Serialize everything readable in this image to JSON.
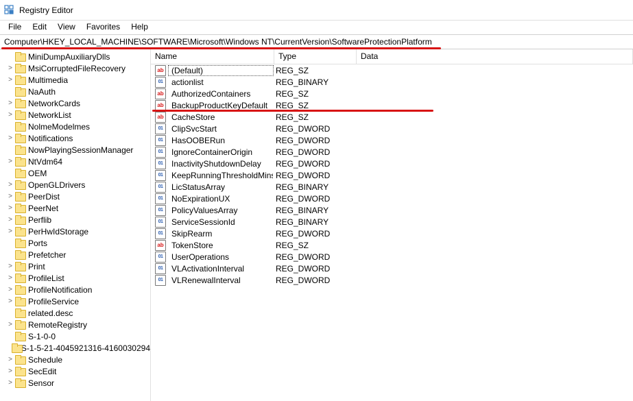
{
  "window": {
    "title": "Registry Editor"
  },
  "menu": {
    "file": "File",
    "edit": "Edit",
    "view": "View",
    "favorites": "Favorites",
    "help": "Help"
  },
  "address": "Computer\\HKEY_LOCAL_MACHINE\\SOFTWARE\\Microsoft\\Windows NT\\CurrentVersion\\SoftwareProtectionPlatform",
  "columns": {
    "name": "Name",
    "type": "Type",
    "data": "Data"
  },
  "tree_items": [
    {
      "name": "MiniDumpAuxiliaryDlls",
      "expander": ""
    },
    {
      "name": "MsiCorruptedFileRecovery",
      "expander": ">"
    },
    {
      "name": "Multimedia",
      "expander": ">"
    },
    {
      "name": "NaAuth",
      "expander": ""
    },
    {
      "name": "NetworkCards",
      "expander": ">"
    },
    {
      "name": "NetworkList",
      "expander": ">"
    },
    {
      "name": "NolmeModelmes",
      "expander": ""
    },
    {
      "name": "Notifications",
      "expander": ">"
    },
    {
      "name": "NowPlayingSessionManager",
      "expander": ""
    },
    {
      "name": "NtVdm64",
      "expander": ">"
    },
    {
      "name": "OEM",
      "expander": ""
    },
    {
      "name": "OpenGLDrivers",
      "expander": ">"
    },
    {
      "name": "PeerDist",
      "expander": ">"
    },
    {
      "name": "PeerNet",
      "expander": ">"
    },
    {
      "name": "Perflib",
      "expander": ">"
    },
    {
      "name": "PerHwIdStorage",
      "expander": ">"
    },
    {
      "name": "Ports",
      "expander": ""
    },
    {
      "name": "Prefetcher",
      "expander": ""
    },
    {
      "name": "Print",
      "expander": ">"
    },
    {
      "name": "ProfileList",
      "expander": ">"
    },
    {
      "name": "ProfileNotification",
      "expander": ">"
    },
    {
      "name": "ProfileService",
      "expander": ">"
    },
    {
      "name": "related.desc",
      "expander": ""
    },
    {
      "name": "RemoteRegistry",
      "expander": ">"
    },
    {
      "name": "S-1-0-0",
      "expander": ""
    },
    {
      "name": "S-1-5-21-4045921316-4160030294",
      "expander": ""
    },
    {
      "name": "Schedule",
      "expander": ">"
    },
    {
      "name": "SecEdit",
      "expander": ">"
    },
    {
      "name": "Sensor",
      "expander": ">"
    }
  ],
  "values": [
    {
      "name": "(Default)",
      "type": "REG_SZ",
      "kind": "sz",
      "selected": true
    },
    {
      "name": "actionlist",
      "type": "REG_BINARY",
      "kind": "bin"
    },
    {
      "name": "AuthorizedContainers",
      "type": "REG_SZ",
      "kind": "sz"
    },
    {
      "name": "BackupProductKeyDefault",
      "type": "REG_SZ",
      "kind": "sz",
      "highlightAfter": true
    },
    {
      "name": "CacheStore",
      "type": "REG_SZ",
      "kind": "sz"
    },
    {
      "name": "ClipSvcStart",
      "type": "REG_DWORD",
      "kind": "bin"
    },
    {
      "name": "HasOOBERun",
      "type": "REG_DWORD",
      "kind": "bin"
    },
    {
      "name": "IgnoreContainerOrigin",
      "type": "REG_DWORD",
      "kind": "bin"
    },
    {
      "name": "InactivityShutdownDelay",
      "type": "REG_DWORD",
      "kind": "bin"
    },
    {
      "name": "KeepRunningThresholdMins",
      "type": "REG_DWORD",
      "kind": "bin"
    },
    {
      "name": "LicStatusArray",
      "type": "REG_BINARY",
      "kind": "bin"
    },
    {
      "name": "NoExpirationUX",
      "type": "REG_DWORD",
      "kind": "bin"
    },
    {
      "name": "PolicyValuesArray",
      "type": "REG_BINARY",
      "kind": "bin"
    },
    {
      "name": "ServiceSessionId",
      "type": "REG_BINARY",
      "kind": "bin"
    },
    {
      "name": "SkipRearm",
      "type": "REG_DWORD",
      "kind": "bin"
    },
    {
      "name": "TokenStore",
      "type": "REG_SZ",
      "kind": "sz"
    },
    {
      "name": "UserOperations",
      "type": "REG_DWORD",
      "kind": "bin"
    },
    {
      "name": "VLActivationInterval",
      "type": "REG_DWORD",
      "kind": "bin"
    },
    {
      "name": "VLRenewalInterval",
      "type": "REG_DWORD",
      "kind": "bin"
    }
  ]
}
